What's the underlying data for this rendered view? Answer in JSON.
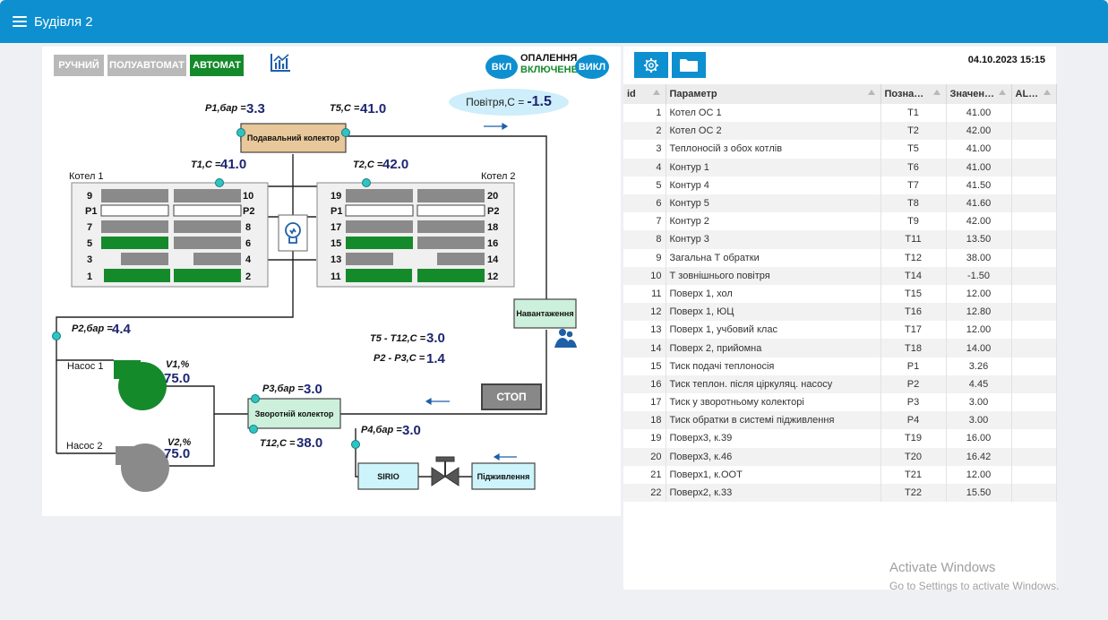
{
  "app": {
    "title": "Будівля 2"
  },
  "modes": {
    "manual": "РУЧНИЙ",
    "semi": "ПОЛУАВТОМАТ",
    "auto": "АВТОМАТ"
  },
  "heating": {
    "on_label": "ВКЛ",
    "off_label": "ВИКЛ",
    "title": "ОПАЛЕННЯ",
    "status": "ВКЛЮЧЕНЕ"
  },
  "air": {
    "label": "Повітря,С =",
    "value": "-1.5"
  },
  "scheme": {
    "p1": {
      "label": "P1,бар =",
      "value": "3.3"
    },
    "t5": {
      "label": "T5,C =",
      "value": "41.0"
    },
    "t1": {
      "label": "T1,C =",
      "value": "41.0"
    },
    "t2": {
      "label": "T2,C =",
      "value": "42.0"
    },
    "p2": {
      "label": "P2,бар =",
      "value": "4.4"
    },
    "p3": {
      "label": "P3,бар =",
      "value": "3.0"
    },
    "p4": {
      "label": "P4,бар =",
      "value": "3.0"
    },
    "t12": {
      "label": "T12,C =",
      "value": "38.0"
    },
    "v1": {
      "label": "V1,%",
      "value": "75.0"
    },
    "v2": {
      "label": "V2,%",
      "value": "75.0"
    },
    "diff_t": {
      "label": "T5 - T12,C =",
      "value": "3.0"
    },
    "diff_p": {
      "label": "P2 - P3,C =",
      "value": "1.4"
    },
    "supply_collector": "Подавальний колектор",
    "return_collector": "Зворотній колектор",
    "load": "Навантаження",
    "sirio": "SIRIO",
    "makeup": "Підживлення",
    "pump1": "Насос 1",
    "pump2": "Насос 2",
    "stop": "СТОП",
    "boiler1": {
      "name": "Котел 1",
      "left_labels": [
        "9",
        "P1",
        "7",
        "5",
        "3",
        "1"
      ],
      "right_labels": [
        "10",
        "P2",
        "8",
        "6",
        "4",
        "2"
      ]
    },
    "boiler2": {
      "name": "Котел 2",
      "left_labels": [
        "19",
        "P1",
        "17",
        "15",
        "13",
        "11"
      ],
      "right_labels": [
        "20",
        "P2",
        "18",
        "16",
        "14",
        "12"
      ]
    },
    "colors": {
      "active": "#158a2b",
      "idle": "#8a8a8a",
      "pipe": "#222222",
      "sensor": "#2ec4c4",
      "collector_supply": "#e8c89a",
      "collector_return": "#ccf0dc"
    }
  },
  "table": {
    "datetime": "04.10.2023 15:15",
    "columns": [
      "id",
      "Параметр",
      "Позна…",
      "Значен…",
      "AL…"
    ],
    "rows": [
      {
        "id": "1",
        "param": "Котел ОС 1",
        "code": "T1",
        "value": "41.00"
      },
      {
        "id": "2",
        "param": "Котел ОС 2",
        "code": "T2",
        "value": "42.00"
      },
      {
        "id": "3",
        "param": "Теплоносій з обох котлів",
        "code": "T5",
        "value": "41.00"
      },
      {
        "id": "4",
        "param": "Контур 1",
        "code": "T6",
        "value": "41.00"
      },
      {
        "id": "5",
        "param": "Контур 4",
        "code": "T7",
        "value": "41.50"
      },
      {
        "id": "6",
        "param": "Контур 5",
        "code": "T8",
        "value": "41.60"
      },
      {
        "id": "7",
        "param": "Контур 2",
        "code": "T9",
        "value": "42.00"
      },
      {
        "id": "8",
        "param": "Контур 3",
        "code": "T11",
        "value": "13.50"
      },
      {
        "id": "9",
        "param": "Загальна Т обратки",
        "code": "T12",
        "value": "38.00"
      },
      {
        "id": "10",
        "param": "Т зовнішнього повітря",
        "code": "T14",
        "value": "-1.50"
      },
      {
        "id": "11",
        "param": "Поверх 1, хол",
        "code": "T15",
        "value": "12.00"
      },
      {
        "id": "12",
        "param": "Поверх 1, ЮЦ",
        "code": "T16",
        "value": "12.80"
      },
      {
        "id": "13",
        "param": "Поверх 1, учбовий клас",
        "code": "T17",
        "value": "12.00"
      },
      {
        "id": "14",
        "param": "Поверх 2, прийомна",
        "code": "T18",
        "value": "14.00"
      },
      {
        "id": "15",
        "param": "Тиск подачі теплоносія",
        "code": "P1",
        "value": "3.26"
      },
      {
        "id": "16",
        "param": "Тиск теплон. після ціркуляц. насосу",
        "code": "P2",
        "value": "4.45"
      },
      {
        "id": "17",
        "param": "Тиск у зворотньому колекторі",
        "code": "P3",
        "value": "3.00"
      },
      {
        "id": "18",
        "param": "Тиск обратки в системі підживлення",
        "code": "P4",
        "value": "3.00"
      },
      {
        "id": "19",
        "param": "Поверх3, к.39",
        "code": "T19",
        "value": "16.00"
      },
      {
        "id": "20",
        "param": "Поверх3, к.46",
        "code": "T20",
        "value": "16.42"
      },
      {
        "id": "21",
        "param": "Поверх1, к.ООТ",
        "code": "T21",
        "value": "12.00"
      },
      {
        "id": "22",
        "param": "Поверх2, к.33",
        "code": "T22",
        "value": "15.50"
      }
    ]
  },
  "watermark": {
    "title": "Activate Windows",
    "subtitle": "Go to Settings to activate Windows."
  }
}
